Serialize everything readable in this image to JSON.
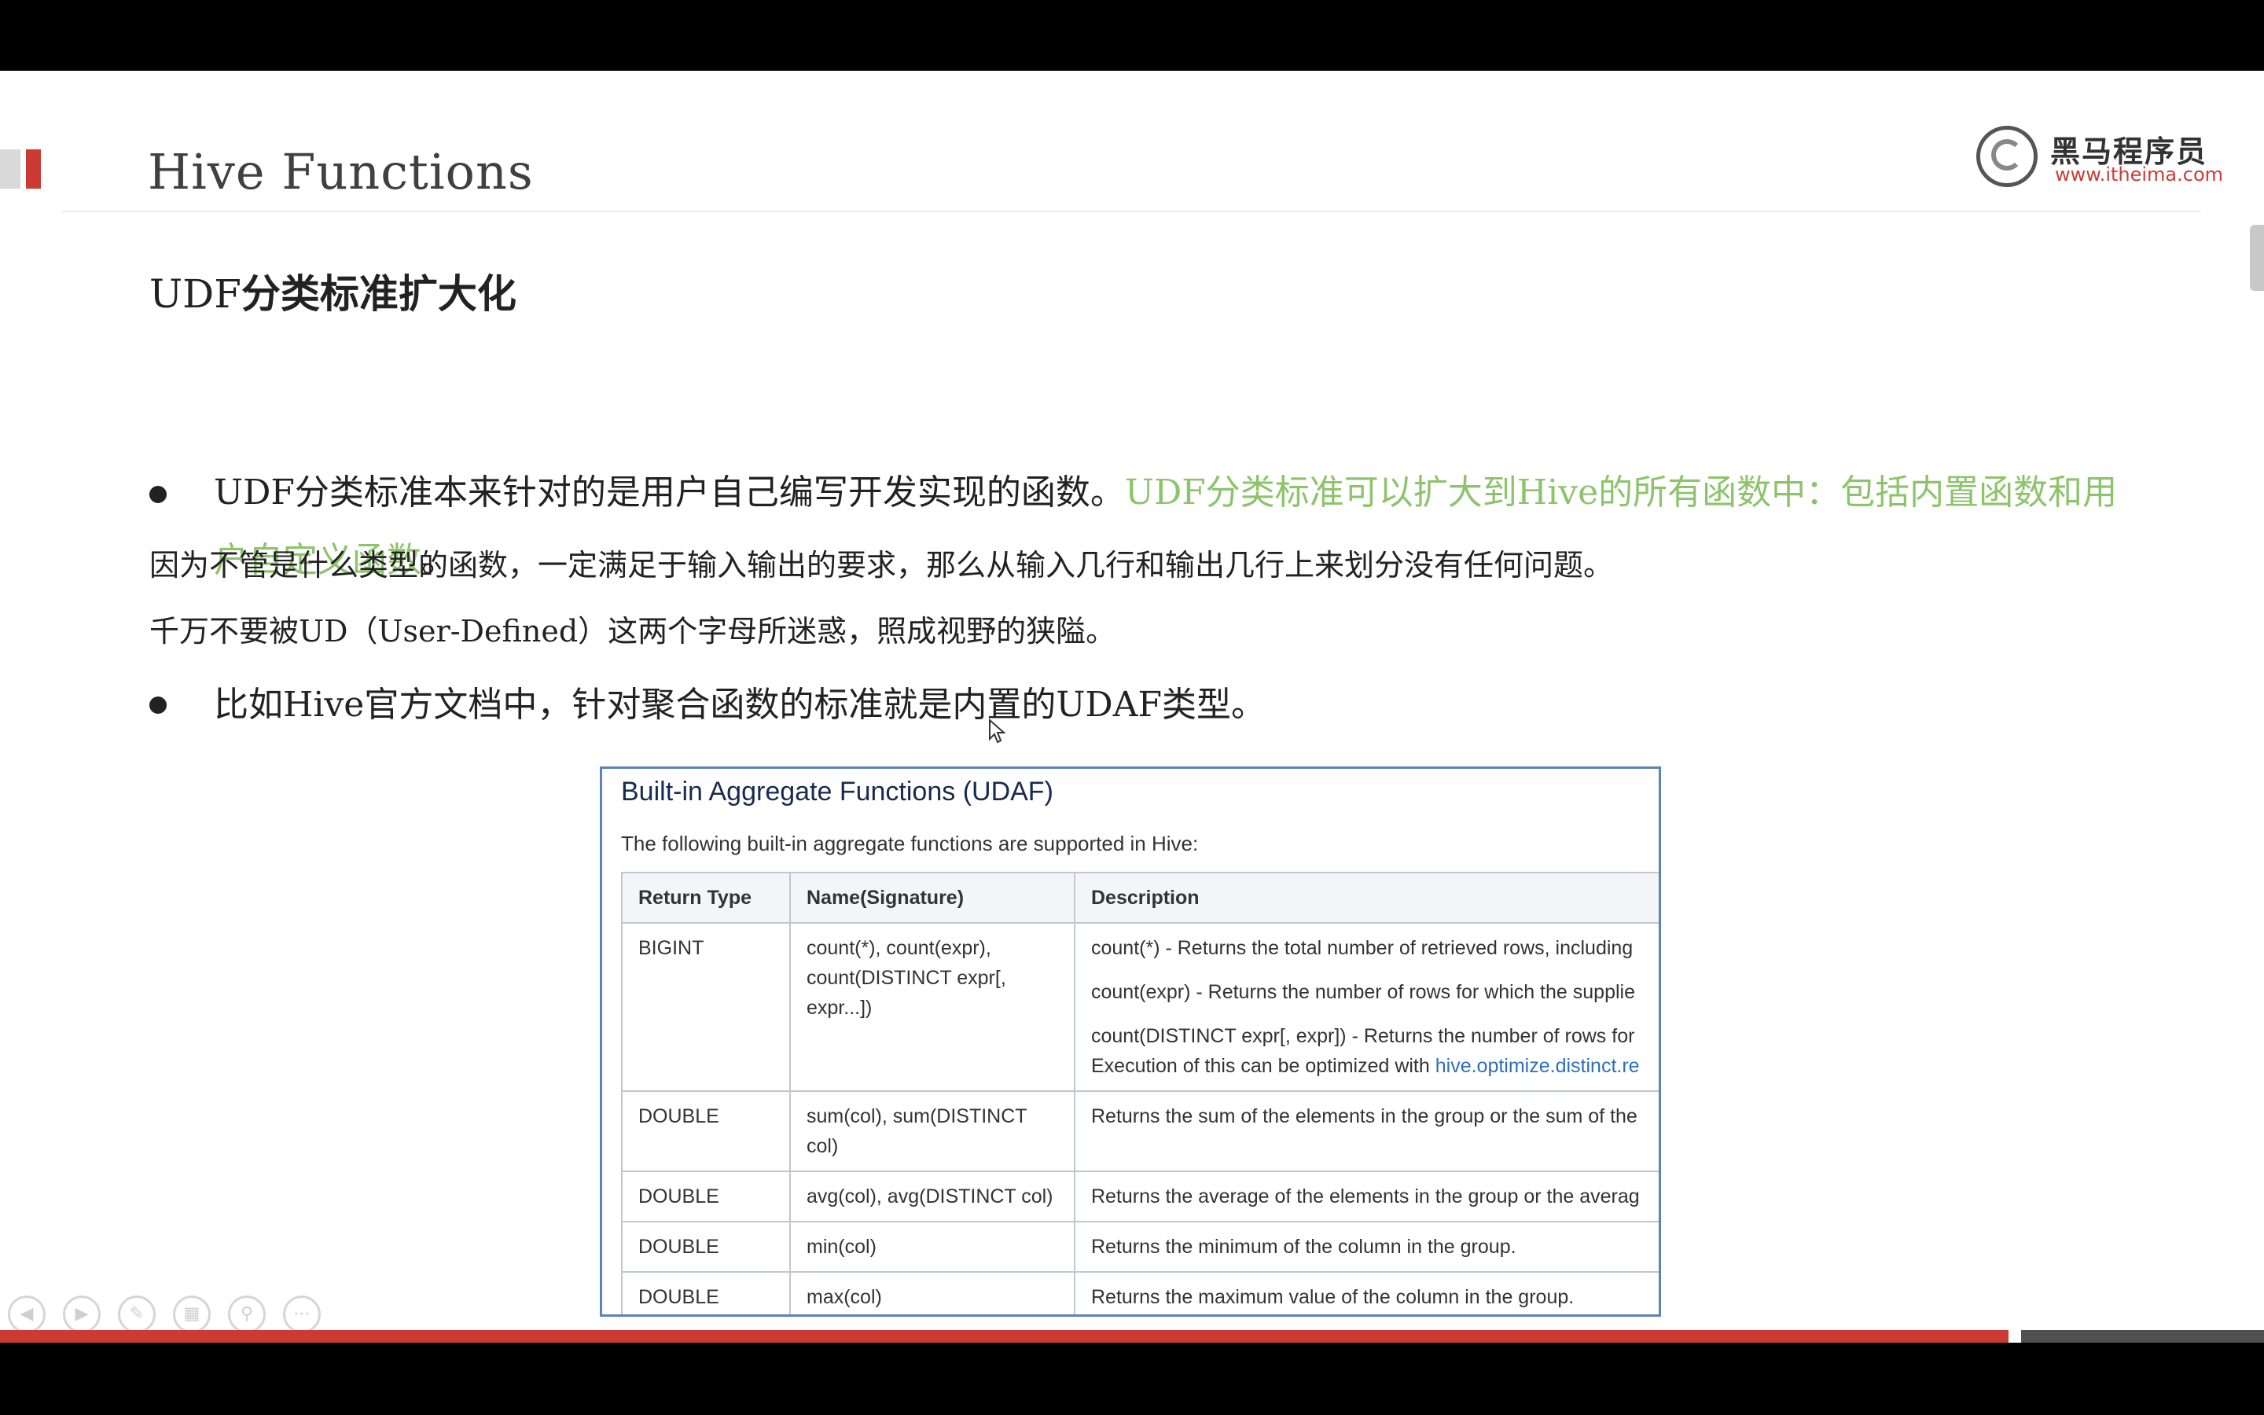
{
  "slide": {
    "title": "Hive Functions",
    "logo": {
      "text": "黑马程序员",
      "url": "www.itheima.com"
    },
    "heading_prefix": "UDF",
    "heading_rest": "分类标准扩大化",
    "bullet1": {
      "a_serif": "UDF",
      "b": "分类标准本来针对的是用户自己编写开发实现的函数。",
      "c_serif": "UDF",
      "d": "分类标准可以扩大到",
      "e_serif": "Hive",
      "f": "的所有函数中：包括内置函数和用户自定义函数",
      "g": "。"
    },
    "line2": "因为不管是什么类型的函数，一定满足于输入输出的要求，那么从输入几行和输出几行上来划分没有任何问题。",
    "line3": {
      "a": "千万不要被",
      "b_serif": "UD",
      "c": "（",
      "d_serif": "User-Defined",
      "e": "）这两个字母所迷惑，照成视野的狭隘。"
    },
    "bullet2": {
      "a": "比如",
      "b_serif": "Hive",
      "c": "官方文档中，针对聚合函数的标准就是内置的",
      "d_serif": "UDAF",
      "e": "类型。"
    }
  },
  "table_panel": {
    "title": "Built-in Aggregate Functions (UDAF)",
    "subtitle": "The following built-in aggregate functions are supported in Hive:",
    "headers": [
      "Return Type",
      "Name(Signature)",
      "Description"
    ],
    "rows": [
      {
        "type": "BIGINT",
        "name": "count(*), count(expr), count(DISTINCT expr[, expr...])",
        "desc1": "count(*) - Returns the total number of retrieved rows, including",
        "desc2": "count(expr) - Returns the number of rows for which the supplie",
        "desc3": "count(DISTINCT expr[, expr]) - Returns the number of rows for",
        "desc4_prefix": "Execution of this can be optimized with ",
        "desc4_link": "hive.optimize.distinct.re"
      },
      {
        "type": "DOUBLE",
        "name": "sum(col), sum(DISTINCT col)",
        "desc": "Returns the sum of the elements in the group or the sum of the"
      },
      {
        "type": "DOUBLE",
        "name": "avg(col), avg(DISTINCT col)",
        "desc": "Returns the average of the elements in the group or the averag"
      },
      {
        "type": "DOUBLE",
        "name": "min(col)",
        "desc": "Returns the minimum of the column in the group."
      },
      {
        "type": "DOUBLE",
        "name": "max(col)",
        "desc": "Returns the maximum value of the column in the group."
      }
    ]
  },
  "progress": {
    "fraction": 0.887
  },
  "colors": {
    "accent_red": "#cc3b33",
    "highlight_green": "#8dc46b",
    "table_border": "#5a83b8",
    "link_blue": "#2f6fba"
  },
  "nav_tools": [
    "back-icon",
    "forward-icon",
    "pen-icon",
    "slides-icon",
    "zoom-icon",
    "more-icon"
  ]
}
